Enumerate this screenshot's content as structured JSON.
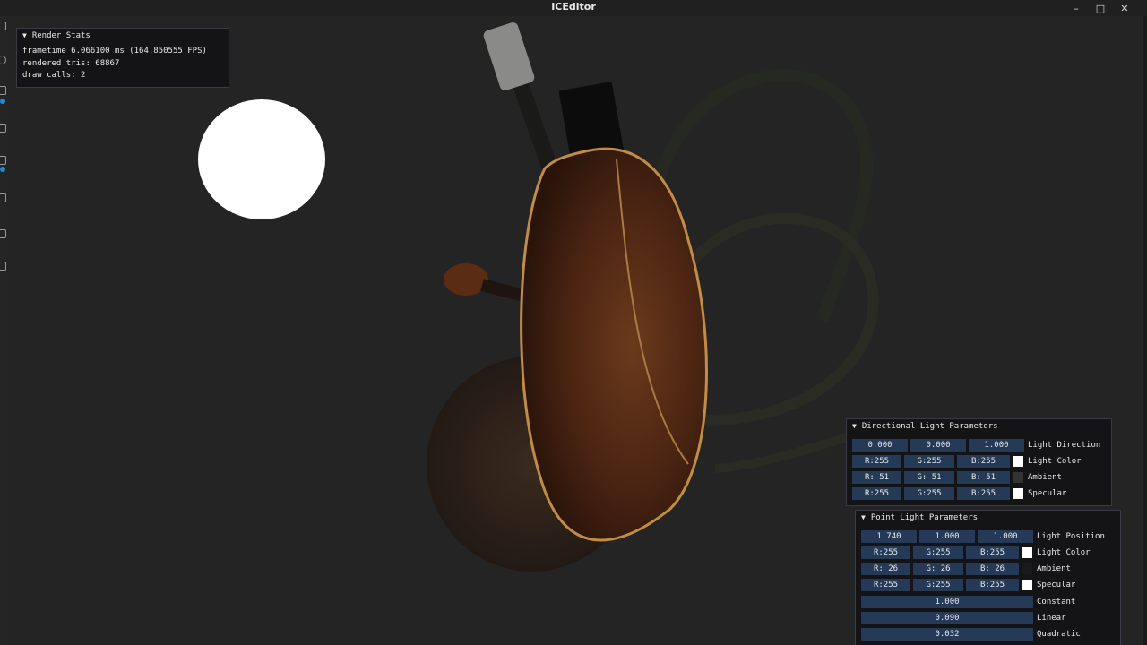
{
  "window": {
    "title": "ICEditor",
    "minimize": "–",
    "maximize": "□",
    "close": "✕"
  },
  "render_stats": {
    "title": "Render Stats",
    "frametime": "frametime 6.066100 ms (164.850555 FPS)",
    "tris": "rendered tris: 68867",
    "draw_calls": "draw calls: 2"
  },
  "directional_light": {
    "title": "Directional Light Parameters",
    "direction": {
      "label": "Light Direction",
      "x": "0.000",
      "y": "0.000",
      "z": "1.000"
    },
    "color": {
      "label": "Light Color",
      "r": "R:255",
      "g": "G:255",
      "b": "B:255",
      "swatch": "#ffffff"
    },
    "ambient": {
      "label": "Ambient",
      "r": "R: 51",
      "g": "G: 51",
      "b": "B: 51",
      "swatch": "#333333"
    },
    "specular": {
      "label": "Specular",
      "r": "R:255",
      "g": "G:255",
      "b": "B:255",
      "swatch": "#ffffff"
    }
  },
  "point_light": {
    "title": "Point Light Parameters",
    "position": {
      "label": "Light Position",
      "x": "1.740",
      "y": "1.000",
      "z": "1.000"
    },
    "color": {
      "label": "Light Color",
      "r": "R:255",
      "g": "G:255",
      "b": "B:255",
      "swatch": "#ffffff"
    },
    "ambient": {
      "label": "Ambient",
      "r": "R: 26",
      "g": "G: 26",
      "b": "B: 26",
      "swatch": "#1a1a1a"
    },
    "specular": {
      "label": "Specular",
      "r": "R:255",
      "g": "G:255",
      "b": "B:255",
      "swatch": "#ffffff"
    },
    "constant": {
      "label": "Constant",
      "value": "1.000"
    },
    "linear": {
      "label": "Linear",
      "value": "0.090"
    },
    "quadratic": {
      "label": "Quadratic",
      "value": "0.032"
    }
  },
  "colors": {
    "accent": "#253a56",
    "panel_bg": "#141416",
    "background": "#242424"
  }
}
